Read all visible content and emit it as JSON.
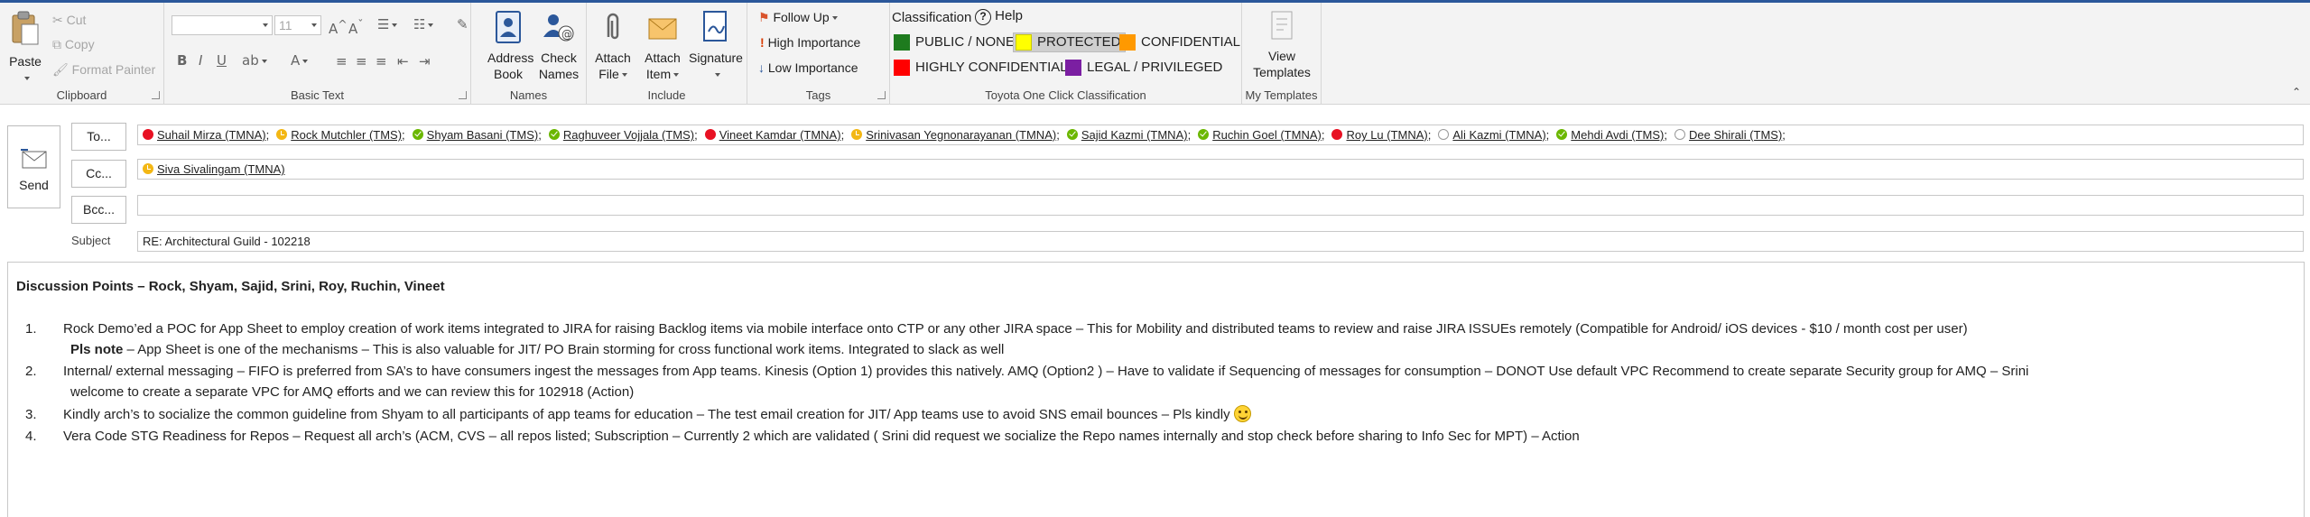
{
  "ribbon": {
    "clipboard": {
      "group_label": "Clipboard",
      "paste": "Paste",
      "cut": "Cut",
      "copy": "Copy",
      "format_painter": "Format Painter"
    },
    "basic_text": {
      "group_label": "Basic Text",
      "font_size": "11"
    },
    "names": {
      "group_label": "Names",
      "address_book_1": "Address",
      "address_book_2": "Book",
      "check_names_1": "Check",
      "check_names_2": "Names"
    },
    "include": {
      "group_label": "Include",
      "attach_file_1": "Attach",
      "attach_file_2": "File",
      "attach_item_1": "Attach",
      "attach_item_2": "Item",
      "signature": "Signature"
    },
    "tags": {
      "group_label": "Tags",
      "follow_up": "Follow Up",
      "high_importance": "High Importance",
      "low_importance": "Low Importance"
    },
    "classification": {
      "group_label": "Toyota One Click Classification",
      "title": "Classification",
      "help": "Help",
      "options": [
        {
          "label": "PUBLIC / NONE",
          "color": "#1e7b1e"
        },
        {
          "label": "PROTECTED",
          "color": "#ffff00"
        },
        {
          "label": "CONFIDENTIAL",
          "color": "#ff9900"
        },
        {
          "label": "HIGHLY CONFIDENTIAL",
          "color": "#ff0000"
        },
        {
          "label": "LEGAL / PRIVILEGED",
          "color": "#7b1fa2"
        }
      ],
      "selected": "PROTECTED"
    },
    "templates": {
      "group_label": "My Templates",
      "view_templates_1": "View",
      "view_templates_2": "Templates"
    }
  },
  "header": {
    "send": "Send",
    "to_button": "To...",
    "cc_button": "Cc...",
    "bcc_button": "Bcc...",
    "subject_label": "Subject",
    "subject_value": "RE: Architectural Guild - 102218",
    "to_recipients": [
      {
        "name": "Suhail Mirza (TMNA)",
        "status": "red"
      },
      {
        "name": "Rock Mutchler (TMS)",
        "status": "away"
      },
      {
        "name": "Shyam Basani (TMS)",
        "status": "green"
      },
      {
        "name": "Raghuveer Vojjala (TMS)",
        "status": "green"
      },
      {
        "name": "Vineet Kamdar (TMNA)",
        "status": "red"
      },
      {
        "name": "Srinivasan Yegnonarayanan (TMNA)",
        "status": "away"
      },
      {
        "name": "Sajid Kazmi (TMNA)",
        "status": "green"
      },
      {
        "name": "Ruchin Goel (TMNA)",
        "status": "green"
      },
      {
        "name": "Roy Lu (TMNA)",
        "status": "red"
      },
      {
        "name": "Ali Kazmi (TMNA)",
        "status": "off"
      },
      {
        "name": "Mehdi Avdi (TMS)",
        "status": "green"
      },
      {
        "name": "Dee Shirali (TMS)",
        "status": "off"
      }
    ],
    "cc_recipients": [
      {
        "name": "Siva Sivalingam (TMNA)",
        "status": "away"
      }
    ]
  },
  "body": {
    "heading": "Discussion Points – Rock, Shyam, Sajid, Srini, Roy, Ruchin, Vineet",
    "items": [
      {
        "num": "1.",
        "line1": "Rock Demo’ed a POC for App Sheet to employ creation of work items integrated to JIRA for raising Backlog items via mobile interface onto CTP or any other JIRA space – This for Mobility and distributed teams to review and raise JIRA ISSUEs remotely (Compatible for Android/ iOS devices - $10 / month cost per user)",
        "note_bold": "Pls note",
        "note_rest": " – App Sheet is one of the mechanisms – This is also valuable for JIT/ PO Brain storming for cross functional work items. Integrated to slack as well"
      },
      {
        "num": "2.",
        "line1": "Internal/ external messaging – FIFO is preferred from SA’s to have consumers ingest the messages from App teams. Kinesis (Option 1) provides this natively. AMQ (Option2 ) – Have to validate if Sequencing of messages for consumption – DONOT Use default VPC Recommend to create separate Security group for AMQ – Srini",
        "line2": "welcome to create a separate VPC for AMQ efforts and we can review this for 102918 (Action)"
      },
      {
        "num": "3.",
        "line1": "Kindly arch’s to socialize the common guideline from Shyam to all participants of app teams for education – The test email creation for JIT/ App teams use to avoid SNS email bounces – Pls kindly"
      },
      {
        "num": "4.",
        "line1": "Vera Code STG Readiness for Repos – Request all arch’s (ACM, CVS – all repos listed; Subscription – Currently 2 which are validated ( Srini did request we socialize the Repo names internally and stop check before sharing to Info Sec for MPT) – Action"
      }
    ]
  }
}
